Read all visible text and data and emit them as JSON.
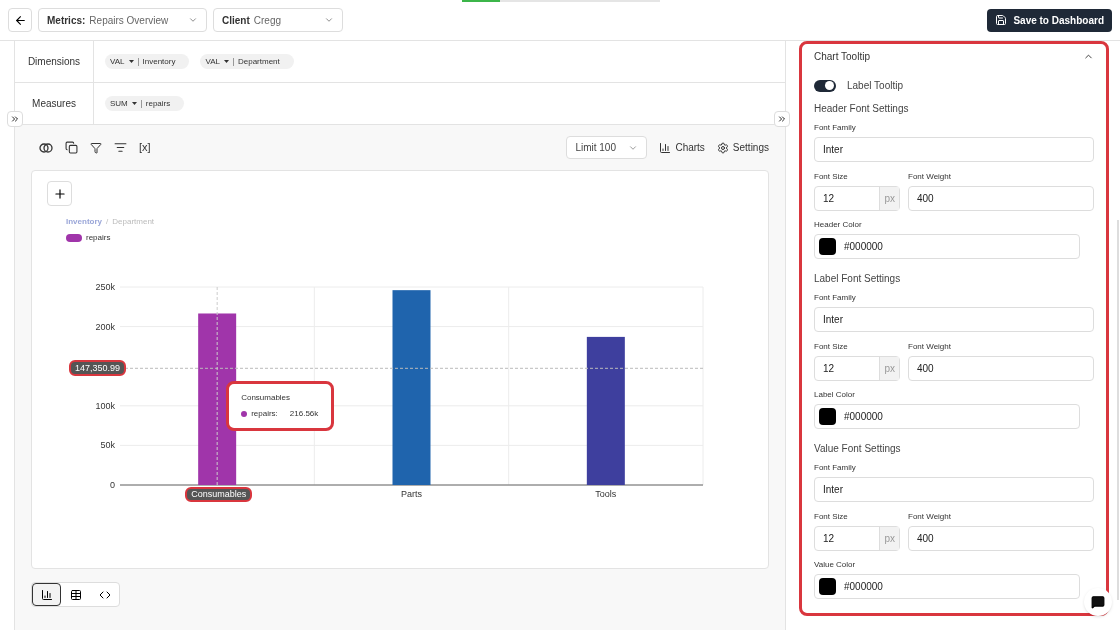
{
  "header": {
    "selects": [
      {
        "label": "Metrics:",
        "value": "Repairs Overview"
      },
      {
        "label": "Client",
        "value": "Cregg"
      }
    ],
    "save_button": "Save to Dashboard"
  },
  "query": {
    "rows": [
      {
        "label": "Dimensions",
        "chips": [
          {
            "agg": "VAL",
            "field": "Inventory"
          },
          {
            "agg": "VAL",
            "field": "Department"
          }
        ]
      },
      {
        "label": "Measures",
        "chips": [
          {
            "agg": "SUM",
            "field": "repairs"
          }
        ]
      }
    ]
  },
  "toolbar": {
    "variable_tool": "[x]",
    "limit": "Limit 100",
    "charts": "Charts",
    "settings": "Settings"
  },
  "chart": {
    "breadcrumb": [
      {
        "text": "Inventory",
        "selected": true
      },
      {
        "text": "Department",
        "selected": false
      }
    ],
    "separator": "/",
    "chart_data": {
      "type": "bar",
      "categories": [
        "Consumables",
        "Parts",
        "Tools"
      ],
      "series": [
        {
          "name": "repairs",
          "values": [
            216560,
            246000,
            187000
          ]
        }
      ],
      "ylim": [
        0,
        250000
      ],
      "grid": true,
      "yticks": [
        {
          "value": 0,
          "label": "0"
        },
        {
          "value": 50000,
          "label": "50k"
        },
        {
          "value": 100000,
          "label": "100k"
        },
        {
          "value": 200000,
          "label": "200k"
        },
        {
          "value": 250000,
          "label": "250k"
        }
      ],
      "ref_lines": [
        {
          "axis": "y",
          "value": 147350.99,
          "label": "147,350.99"
        },
        {
          "axis": "x",
          "value": "Consumables"
        }
      ]
    },
    "bar_styles": [
      {
        "color": "#a035aa"
      },
      {
        "color": "#1f64ad"
      },
      {
        "color": "#3e3f9e"
      }
    ],
    "tooltip": {
      "series": "repairs:",
      "value": "216.56k"
    }
  },
  "view_buttons": [
    {
      "kind": "chart",
      "selected": true
    },
    {
      "kind": "table",
      "selected": false
    },
    {
      "kind": "code",
      "selected": false
    }
  ],
  "panel": {
    "title": "Chart Tooltip",
    "expanded": true,
    "toggle": {
      "label": "Label Tooltip",
      "on": true
    },
    "sections": [
      {
        "title": "Header Font Settings",
        "family_label": "Font Family",
        "family": "Inter",
        "size_label": "Font Size",
        "size": "12",
        "unit": "px",
        "weight_label": "Font Weight",
        "weight": "400",
        "color_label": "Header Color",
        "color_text": "#000000",
        "color": "#000000"
      },
      {
        "title": "Label Font Settings",
        "family_label": "Font Family",
        "family": "Inter",
        "size_label": "Font Size",
        "size": "12",
        "unit": "px",
        "weight_label": "Font Weight",
        "weight": "400",
        "color_label": "Label Color",
        "color_text": "#000000",
        "color": "#000000"
      },
      {
        "title": "Value Font Settings",
        "family_label": "Font Family",
        "family": "Inter",
        "size_label": "Font Size",
        "size": "12",
        "unit": "px",
        "weight_label": "Font Weight",
        "weight": "400",
        "color_label": "Value Color",
        "color_text": "#000000",
        "color": "#000000"
      }
    ]
  }
}
